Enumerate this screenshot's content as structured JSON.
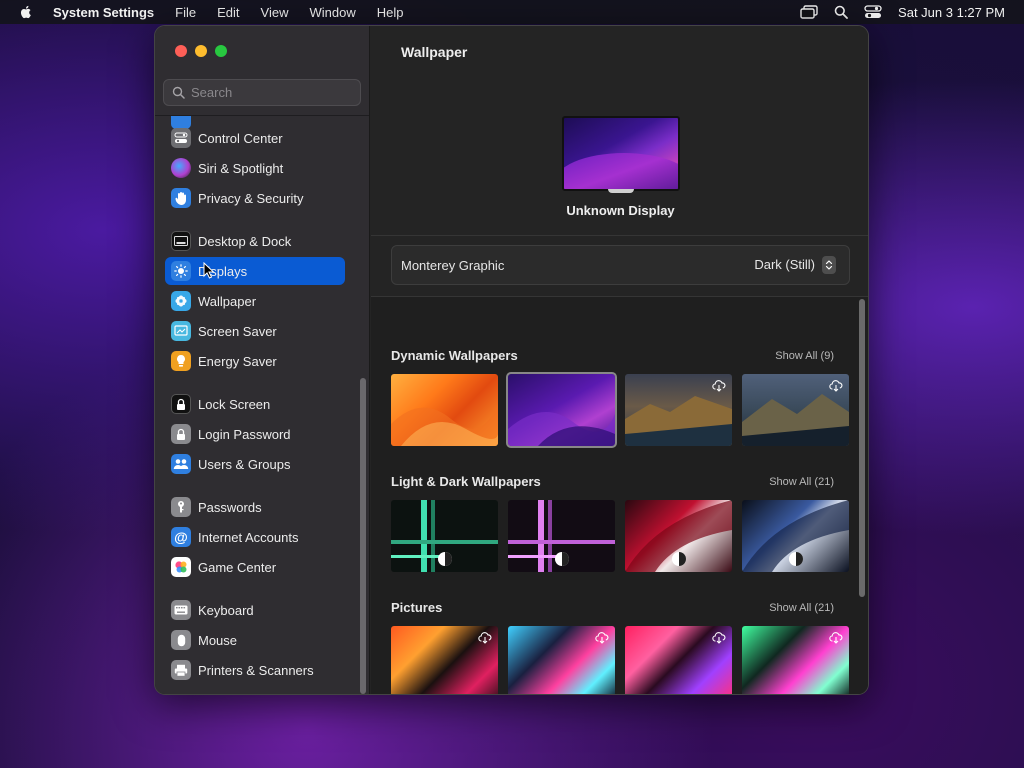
{
  "menubar": {
    "app_name": "System Settings",
    "menus": [
      "File",
      "Edit",
      "View",
      "Window",
      "Help"
    ],
    "clock": "Sat Jun 3  1:27 PM"
  },
  "sidebar": {
    "search_placeholder": "Search",
    "items": [
      {
        "label": "Control Center",
        "icon": "control-center-icon",
        "color": "#7a7a7a"
      },
      {
        "label": "Siri & Spotlight",
        "icon": "siri-icon",
        "color": "#b040d0"
      },
      {
        "label": "Privacy & Security",
        "icon": "hand-icon",
        "color": "#2f7fe0"
      },
      {
        "label": "Desktop & Dock",
        "icon": "dock-icon",
        "color": "#1a1a1a"
      },
      {
        "label": "Displays",
        "icon": "sun-icon",
        "color": "#2f7fe0",
        "selected": true
      },
      {
        "label": "Wallpaper",
        "icon": "flower-icon",
        "color": "#38a8e8"
      },
      {
        "label": "Screen Saver",
        "icon": "screen-saver-icon",
        "color": "#48b8e0"
      },
      {
        "label": "Energy Saver",
        "icon": "bulb-icon",
        "color": "#f0a020"
      },
      {
        "label": "Lock Screen",
        "icon": "lock-icon",
        "color": "#1a1a1a"
      },
      {
        "label": "Login Password",
        "icon": "padlock-icon",
        "color": "#8a8a8a"
      },
      {
        "label": "Users & Groups",
        "icon": "users-icon",
        "color": "#2f7fe0"
      },
      {
        "label": "Passwords",
        "icon": "key-icon",
        "color": "#8a8a8a"
      },
      {
        "label": "Internet Accounts",
        "icon": "at-icon",
        "color": "#2f7fe0"
      },
      {
        "label": "Game Center",
        "icon": "game-center-icon",
        "color": "#ffffff"
      },
      {
        "label": "Keyboard",
        "icon": "keyboard-icon",
        "color": "#8a8a8a"
      },
      {
        "label": "Mouse",
        "icon": "mouse-icon",
        "color": "#8a8a8a"
      },
      {
        "label": "Printers & Scanners",
        "icon": "printer-icon",
        "color": "#8a8a8a"
      }
    ]
  },
  "pane": {
    "title": "Wallpaper",
    "display_name": "Unknown Display",
    "wallpaper_name": "Monterey Graphic",
    "wallpaper_mode": "Dark (Still)"
  },
  "sections": [
    {
      "title": "Dynamic Wallpapers",
      "show_all": "Show All (9)"
    },
    {
      "title": "Light & Dark Wallpapers",
      "show_all": "Show All (21)"
    },
    {
      "title": "Pictures",
      "show_all": "Show All (21)"
    }
  ],
  "colors": {
    "accent": "#0a5bd3",
    "sidebar_bg": "#2f2d31",
    "pane_bg": "#242424"
  }
}
